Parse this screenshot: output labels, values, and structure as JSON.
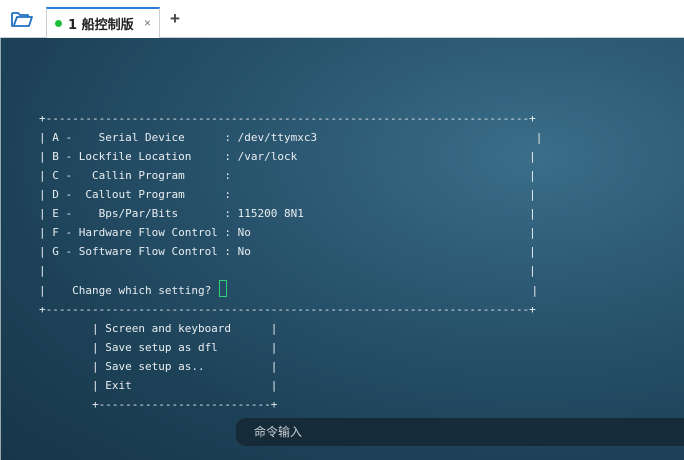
{
  "tabbar": {
    "open_icon": "folder-open-icon",
    "tab": {
      "number": "1",
      "title": "船控制版",
      "close": "×",
      "status_color": "#1fbf3c"
    },
    "add_label": "+"
  },
  "terminal": {
    "setup_menu": {
      "lines": [
        "+-------------------------------------------------------------------------+",
        "| A -    Serial Device      : /dev/ttymxc3                                 |",
        "| B - Lockfile Location     : /var/lock                                   |",
        "| C -   Callin Program      :                                             |",
        "| D -  Callout Program      :                                             |",
        "| E -    Bps/Par/Bits       : 115200 8N1                                  |",
        "| F - Hardware Flow Control : No                                          |",
        "| G - Software Flow Control : No                                          |",
        "|                                                                         |"
      ],
      "prompt": "|    Change which setting? ",
      "prompt_end": "                                              |",
      "bottom": "+-------------------------------------------------------------------------+"
    },
    "config_menu": {
      "lines": [
        "        | Screen and keyboard      |",
        "        | Save setup as dfl        |",
        "        | Save setup as..          |",
        "        | Exit                     |",
        "        +--------------------------+"
      ]
    }
  },
  "command_bar": {
    "placeholder": "命令输入"
  }
}
